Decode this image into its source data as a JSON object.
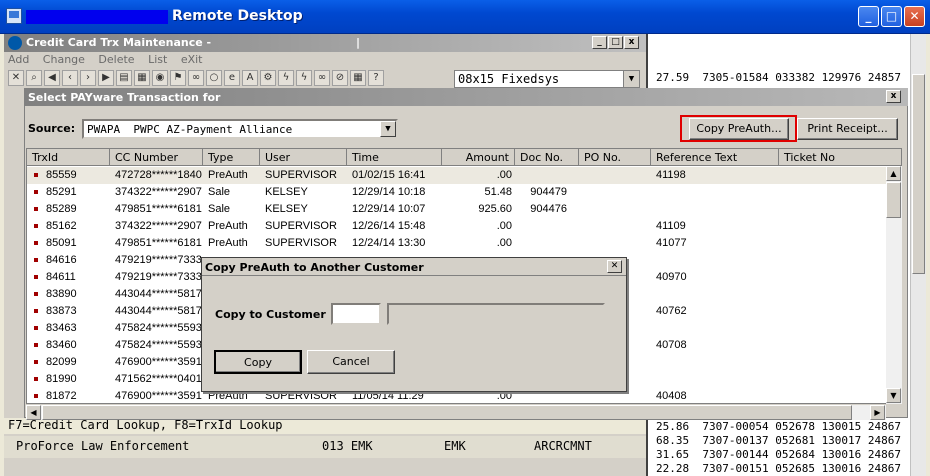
{
  "remote_desktop": {
    "title": "Remote Desktop",
    "buttons": {
      "min": "_",
      "max": "□",
      "close": "✕"
    }
  },
  "app": {
    "title": "Credit Card Trx Maintenance -",
    "title_suffix": "|",
    "menu": [
      "Add",
      "Change",
      "Delete",
      "List",
      "eXit"
    ],
    "font_select": "08x15 Fixedsys"
  },
  "terminal": {
    "lines_top": [
      "27.59  7305-01584 033382 129976 24857"
    ],
    "lines_bottom": [
      "25.86  7307-00054 052678 130015 24867",
      "68.35  7307-00137 052681 130017 24867",
      "31.65  7307-00144 052684 130016 24867",
      "22.28  7307-00151 052685 130016 24867"
    ]
  },
  "status": {
    "line1": "F7=Credit Card Lookup, F8=TrxId Lookup",
    "company": "ProForce Law Enforcement",
    "code": "013 EMK",
    "user": "EMK",
    "module": "ARCRCMNT"
  },
  "payware": {
    "title": "Select PAYware Transaction for",
    "source_label": "Source:",
    "source_value": "PWAPA  PWPC AZ-Payment Alliance",
    "copy_preauth_label": "Copy PreAuth...",
    "print_receipt_label": "Print Receipt...",
    "columns": [
      "TrxId",
      "CC Number",
      "Type",
      "User",
      "Time",
      "Amount",
      "Doc No.",
      "PO No.",
      "Reference Text",
      "Ticket No"
    ],
    "rows": [
      {
        "trxid": "85559",
        "cc": "472728******1840",
        "type": "PreAuth",
        "user": "SUPERVISOR",
        "time": "01/02/15 16:41",
        "amount": ".00",
        "doc": "",
        "po": "",
        "ref": "41198",
        "ticket": ""
      },
      {
        "trxid": "85291",
        "cc": "374322******2907",
        "type": "Sale",
        "user": "KELSEY",
        "time": "12/29/14 10:18",
        "amount": "51.48",
        "doc": "904479",
        "po": "",
        "ref": "",
        "ticket": ""
      },
      {
        "trxid": "85289",
        "cc": "479851******6181",
        "type": "Sale",
        "user": "KELSEY",
        "time": "12/29/14 10:07",
        "amount": "925.60",
        "doc": "904476",
        "po": "",
        "ref": "",
        "ticket": ""
      },
      {
        "trxid": "85162",
        "cc": "374322******2907",
        "type": "PreAuth",
        "user": "SUPERVISOR",
        "time": "12/26/14 15:48",
        "amount": ".00",
        "doc": "",
        "po": "",
        "ref": "41109",
        "ticket": ""
      },
      {
        "trxid": "85091",
        "cc": "479851******6181",
        "type": "PreAuth",
        "user": "SUPERVISOR",
        "time": "12/24/14 13:30",
        "amount": ".00",
        "doc": "",
        "po": "",
        "ref": "41077",
        "ticket": ""
      },
      {
        "trxid": "84616",
        "cc": "479219******7333",
        "type": "",
        "user": "",
        "time": "",
        "amount": "",
        "doc": "",
        "po": "",
        "ref": "",
        "ticket": ""
      },
      {
        "trxid": "84611",
        "cc": "479219******7333",
        "type": "",
        "user": "",
        "time": "",
        "amount": "",
        "doc": "",
        "po": "",
        "ref": "40970",
        "ticket": ""
      },
      {
        "trxid": "83890",
        "cc": "443044******5817",
        "type": "",
        "user": "",
        "time": "",
        "amount": "",
        "doc": "",
        "po": "",
        "ref": "",
        "ticket": ""
      },
      {
        "trxid": "83873",
        "cc": "443044******5817",
        "type": "",
        "user": "",
        "time": "",
        "amount": "",
        "doc": "",
        "po": "",
        "ref": "40762",
        "ticket": ""
      },
      {
        "trxid": "83463",
        "cc": "475824******5593",
        "type": "",
        "user": "",
        "time": "",
        "amount": "",
        "doc": "",
        "po": "",
        "ref": "",
        "ticket": ""
      },
      {
        "trxid": "83460",
        "cc": "475824******5593",
        "type": "",
        "user": "",
        "time": "",
        "amount": "",
        "doc": "",
        "po": "",
        "ref": "40708",
        "ticket": ""
      },
      {
        "trxid": "82099",
        "cc": "476900******3591",
        "type": "",
        "user": "",
        "time": "",
        "amount": "",
        "doc": "",
        "po": "",
        "ref": "",
        "ticket": ""
      },
      {
        "trxid": "81990",
        "cc": "471562******0401",
        "type": "",
        "user": "",
        "time": "",
        "amount": "",
        "doc": "",
        "po": "",
        "ref": "",
        "ticket": ""
      },
      {
        "trxid": "81872",
        "cc": "476900******3591",
        "type": "PreAuth",
        "user": "SUPERVISOR",
        "time": "11/05/14 11:29",
        "amount": ".00",
        "doc": "",
        "po": "",
        "ref": "40408",
        "ticket": ""
      }
    ]
  },
  "copy_dialog": {
    "title": "Copy PreAuth to Another Customer",
    "label": "Copy to Customer",
    "customer_value": "",
    "customer_name": "",
    "copy_label": "Copy",
    "cancel_label": "Cancel",
    "close": "✕"
  },
  "colors": {
    "highlight_border": "#e00000",
    "titlebar": "#0048d0"
  }
}
